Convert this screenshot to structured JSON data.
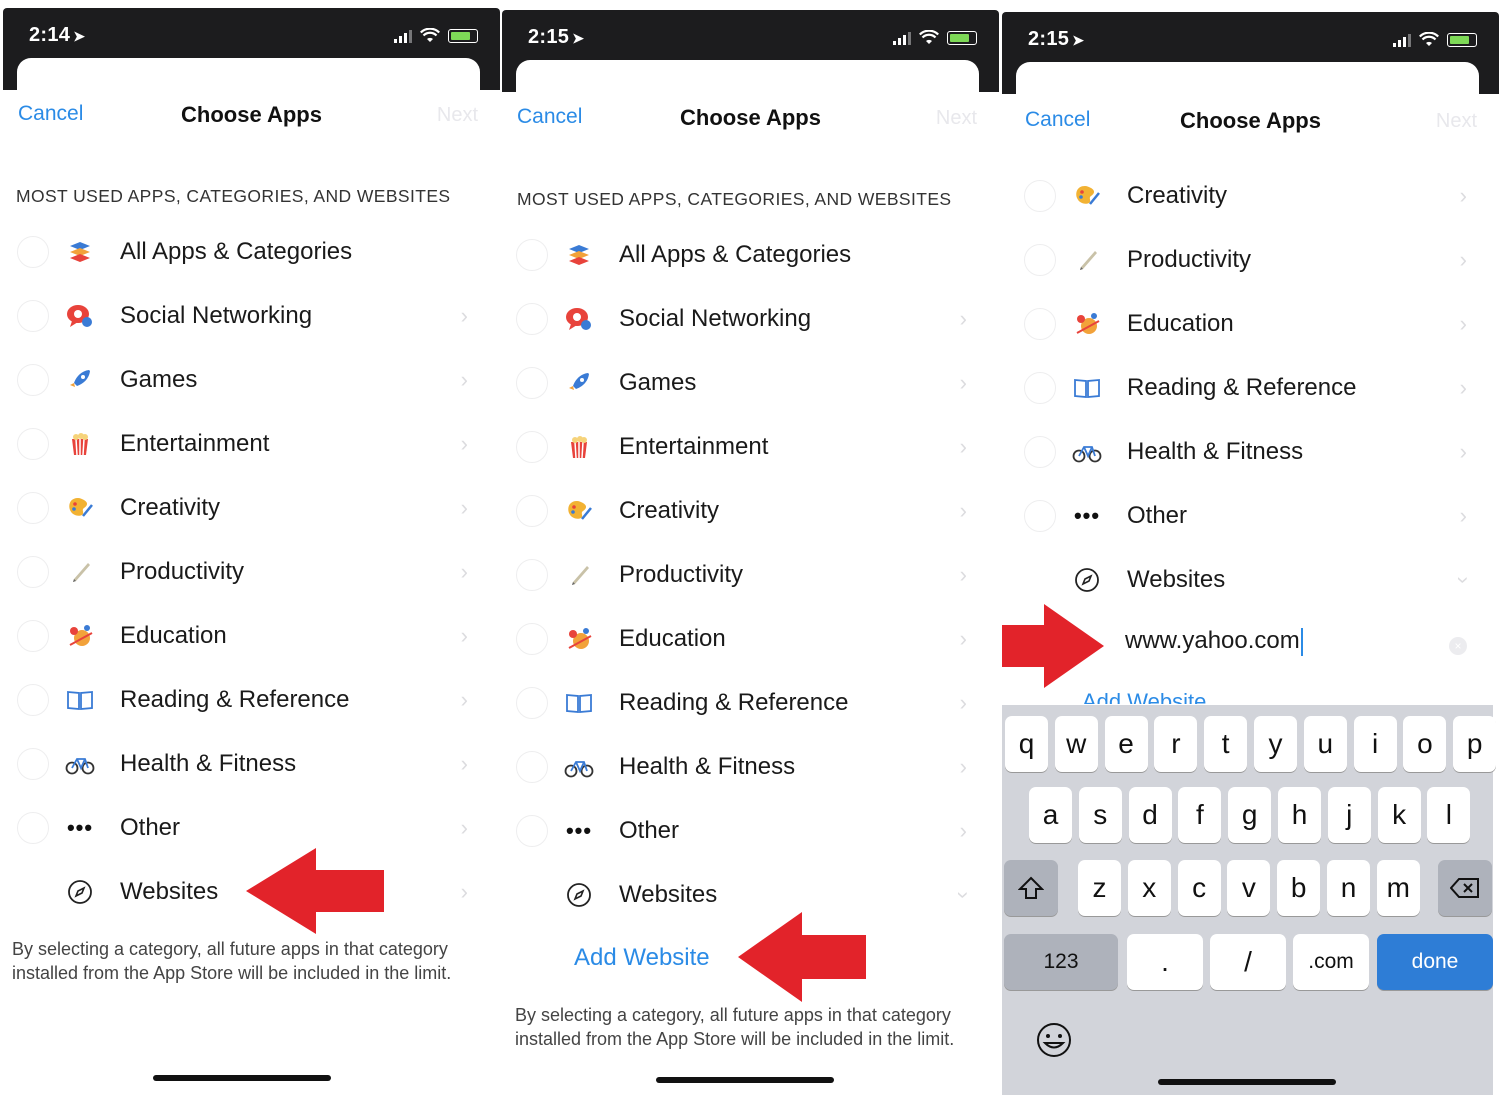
{
  "colors": {
    "accent": "#2b8be6",
    "arrow": "#e2232a",
    "status_bar": "#1c1c1e",
    "keyboard": "#d2d4da",
    "done_key": "#2e7dd6"
  },
  "panels": [
    {
      "time": "2:14",
      "nav": {
        "cancel": "Cancel",
        "title": "Choose Apps",
        "next": "Next"
      },
      "section_header": "MOST USED APPS, CATEGORIES, AND WEBSITES",
      "items": [
        {
          "label": "All Apps & Categories",
          "icon": "stack-icon"
        },
        {
          "label": "Social Networking",
          "icon": "speech-bubble-icon"
        },
        {
          "label": "Games",
          "icon": "rocket-icon"
        },
        {
          "label": "Entertainment",
          "icon": "popcorn-icon"
        },
        {
          "label": "Creativity",
          "icon": "palette-icon"
        },
        {
          "label": "Productivity",
          "icon": "pencil-icon"
        },
        {
          "label": "Education",
          "icon": "education-icon"
        },
        {
          "label": "Reading & Reference",
          "icon": "book-icon"
        },
        {
          "label": "Health & Fitness",
          "icon": "bicycle-icon"
        },
        {
          "label": "Other",
          "icon": "ellipsis-icon"
        },
        {
          "label": "Websites",
          "icon": "compass-icon"
        }
      ],
      "footer": "By selecting a category, all future apps in that category installed from the App Store will be included in the limit."
    },
    {
      "time": "2:15",
      "nav": {
        "cancel": "Cancel",
        "title": "Choose Apps",
        "next": "Next"
      },
      "section_header": "MOST USED APPS, CATEGORIES, AND WEBSITES",
      "items": [
        {
          "label": "All Apps & Categories",
          "icon": "stack-icon"
        },
        {
          "label": "Social Networking",
          "icon": "speech-bubble-icon"
        },
        {
          "label": "Games",
          "icon": "rocket-icon"
        },
        {
          "label": "Entertainment",
          "icon": "popcorn-icon"
        },
        {
          "label": "Creativity",
          "icon": "palette-icon"
        },
        {
          "label": "Productivity",
          "icon": "pencil-icon"
        },
        {
          "label": "Education",
          "icon": "education-icon"
        },
        {
          "label": "Reading & Reference",
          "icon": "book-icon"
        },
        {
          "label": "Health & Fitness",
          "icon": "bicycle-icon"
        },
        {
          "label": "Other",
          "icon": "ellipsis-icon"
        },
        {
          "label": "Websites",
          "icon": "compass-icon"
        }
      ],
      "add_website": "Add Website",
      "footer": "By selecting a category, all future apps in that category installed from the App Store will be included in the limit."
    },
    {
      "time": "2:15",
      "nav": {
        "cancel": "Cancel",
        "title": "Choose Apps",
        "next": "Next"
      },
      "items": [
        {
          "label": "Creativity",
          "icon": "palette-icon"
        },
        {
          "label": "Productivity",
          "icon": "pencil-icon"
        },
        {
          "label": "Education",
          "icon": "education-icon"
        },
        {
          "label": "Reading & Reference",
          "icon": "book-icon"
        },
        {
          "label": "Health & Fitness",
          "icon": "bicycle-icon"
        },
        {
          "label": "Other",
          "icon": "ellipsis-icon"
        },
        {
          "label": "Websites",
          "icon": "compass-icon"
        }
      ],
      "url_value": "www.yahoo.com",
      "add_website_partial": "Add Website",
      "keyboard": {
        "row1": [
          "q",
          "w",
          "e",
          "r",
          "t",
          "y",
          "u",
          "i",
          "o",
          "p"
        ],
        "row2": [
          "a",
          "s",
          "d",
          "f",
          "g",
          "h",
          "j",
          "k",
          "l"
        ],
        "row3": [
          "z",
          "x",
          "c",
          "v",
          "b",
          "n",
          "m"
        ],
        "row4": {
          "numbers": "123",
          "dot": ".",
          "slash": "/",
          "dotcom": ".com",
          "done": "done"
        }
      }
    }
  ]
}
